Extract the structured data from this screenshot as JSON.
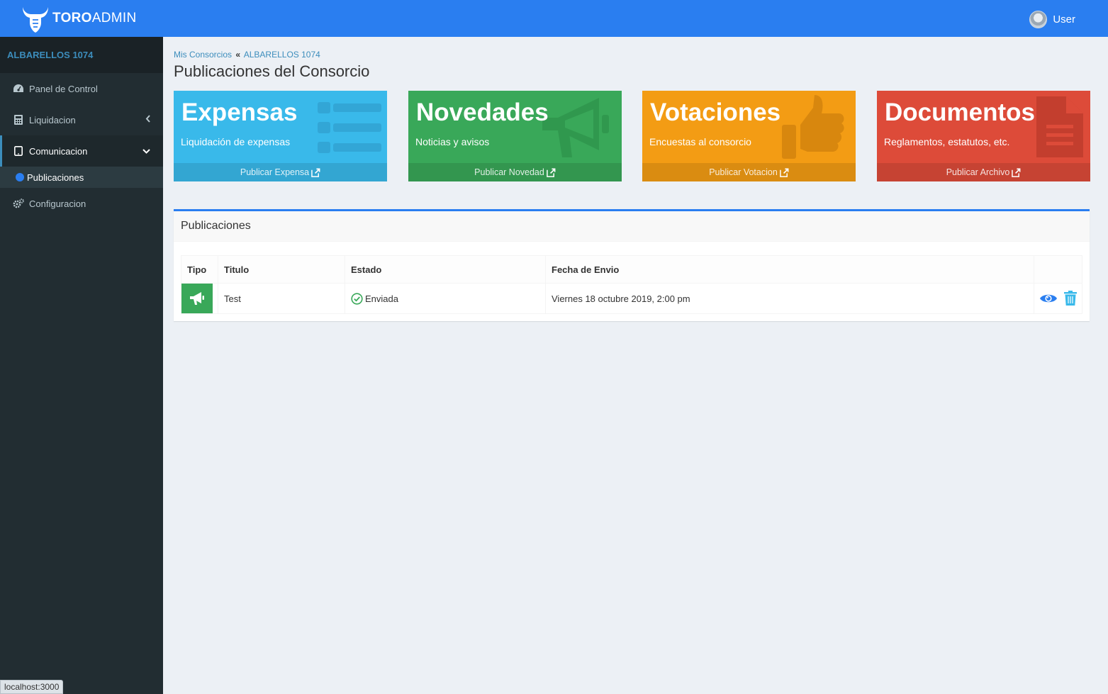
{
  "app": {
    "logo_bold": "TORO",
    "logo_light": "ADMIN"
  },
  "sidebar": {
    "consorcio_name": "ALBARELLOS 1074",
    "items": [
      {
        "label": "Panel de Control",
        "icon": "dashboard-icon"
      },
      {
        "label": "Liquidacion",
        "icon": "calculator-icon",
        "chevron": "chevron-left"
      },
      {
        "label": "Comunicacion",
        "icon": "tablet-icon",
        "chevron": "chevron-down",
        "active": true
      },
      {
        "label": "Configuracion",
        "icon": "gears-icon"
      }
    ],
    "sub_item": {
      "label": "Publicaciones"
    }
  },
  "topbar": {
    "user_label": "User"
  },
  "breadcrumb": {
    "root": "Mis Consorcios",
    "current": "ALBARELLOS 1074"
  },
  "page_title": "Publicaciones del Consorcio",
  "boxes": [
    {
      "heading": "Expensas",
      "sub": "Liquidación de expensas",
      "action": "Publicar Expensa",
      "color": "#39b9ea",
      "icon": "list-icon"
    },
    {
      "heading": "Novedades",
      "sub": "Noticias y avisos",
      "action": "Publicar Novedad",
      "color": "#39a859",
      "icon": "megaphone-icon"
    },
    {
      "heading": "Votaciones",
      "sub": "Encuestas al consorcio",
      "action": "Publicar Votacion",
      "color": "#f39c14",
      "icon": "thumbs-up-icon"
    },
    {
      "heading": "Documentos",
      "sub": "Reglamentos, estatutos, etc.",
      "action": "Publicar Archivo",
      "color": "#dd4b39",
      "icon": "file-text-icon"
    }
  ],
  "panel": {
    "title": "Publicaciones",
    "columns": [
      "Tipo",
      "Titulo",
      "Estado",
      "Fecha de Envio"
    ],
    "rows": [
      {
        "tipo_icon": "megaphone-icon",
        "titulo": "Test",
        "estado": "Enviada",
        "fecha": "Viernes 18 octubre 2019, 2:00 pm"
      }
    ]
  },
  "status_bar": "localhost:3000",
  "colors": {
    "primary": "#2a7ef0",
    "sidebar": "#222d32"
  }
}
